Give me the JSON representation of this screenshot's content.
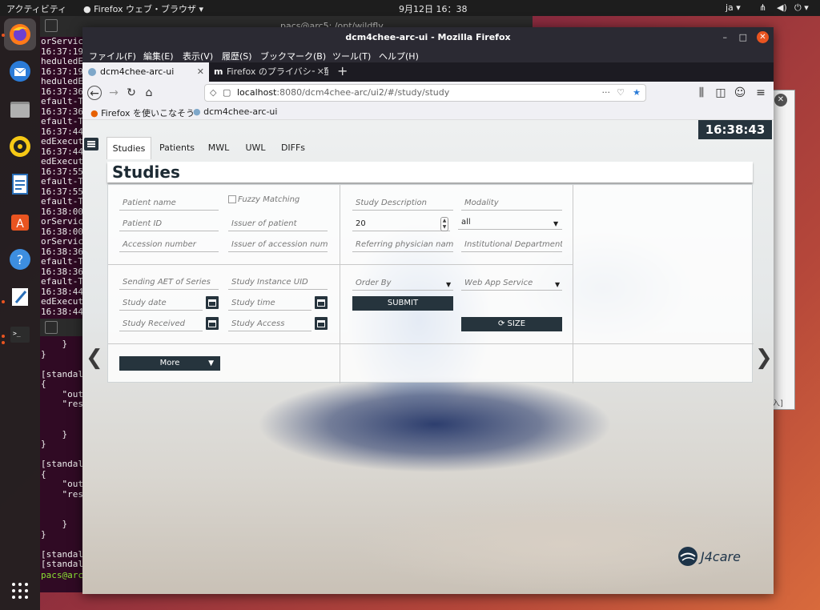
{
  "topbar": {
    "activities": "アクティビティ",
    "app_menu": "Firefox ウェブ・ブラウザ",
    "clock": "9月12日 16：38",
    "lang": "ja"
  },
  "dock": {
    "items": [
      "firefox",
      "thunderbird",
      "files",
      "rhythmbox",
      "writer",
      "software",
      "help",
      "text-editor",
      "terminal",
      "apps-grid"
    ]
  },
  "terminal": {
    "title": "pacs@arc5: /opt/wildfly",
    "lines": [
      "orService",
      "16:37:19",
      "heduledE",
      "16:37:19",
      "heduledE",
      "16:37:36",
      "efault-T",
      "16:37:36",
      "efault-T",
      "16:37:44",
      "edExecut",
      "16:37:44",
      "edExecut",
      "16:37:55",
      "efault-T",
      "16:37:55",
      "efault-T",
      "16:38:00",
      "orService",
      "16:38:00",
      "orService",
      "16:38:36",
      "efault-T",
      "16:38:36",
      "efault-T",
      "16:38:44",
      "edExecut",
      "16:38:44"
    ],
    "bottom": [
      "    }",
      "}",
      "",
      "[standalo",
      "{",
      "    \"outc",
      "    \"resp",
      "",
      "",
      "    }",
      "}",
      "",
      "[standalo",
      "{",
      "    \"outc",
      "    \"resp",
      "",
      "",
      "    }",
      "}",
      "",
      "[standalo",
      "[standalo"
    ],
    "prompt": "pacs@arc"
  },
  "right_window": {
    "text": "入]"
  },
  "firefox": {
    "title": "dcm4chee-arc-ui - Mozilla Firefox",
    "menu": [
      "ファイル(F)",
      "編集(E)",
      "表示(V)",
      "履歴(S)",
      "ブックマーク(B)",
      "ツール(T)",
      "ヘルプ(H)"
    ],
    "tabs": [
      {
        "label": "dcm4chee-arc-ui",
        "active": true
      },
      {
        "label": "Firefox のプライバシー通知",
        "active": false
      }
    ],
    "url_host": "localhost",
    "url_path": ":8080/dcm4chee-arc/ui2/#/study/study",
    "bookmarks": [
      "Firefox を使いこなそう",
      "dcm4chee-arc-ui"
    ]
  },
  "app": {
    "clock": "16:38:43",
    "tabs": [
      "Studies",
      "Patients",
      "MWL",
      "UWL",
      "DIFFs"
    ],
    "active_tab": "Studies",
    "title": "Studies",
    "filters": {
      "patient_name": "Patient name",
      "fuzzy_matching": "Fuzzy Matching",
      "patient_id": "Patient ID",
      "issuer_of_patient": "Issuer of patient",
      "accession_number": "Accession number",
      "issuer_of_accession": "Issuer of accession number",
      "study_description": "Study Description",
      "modality": "Modality",
      "limit_value": "20",
      "modality_value": "all",
      "referring_physician": "Referring physician name",
      "institutional_department": "Institutional Department",
      "sending_aet": "Sending AET of Series",
      "study_instance_uid": "Study Instance UID",
      "study_date": "Study date",
      "study_time": "Study time",
      "study_received": "Study Received",
      "study_access": "Study Access",
      "order_by": "Order By",
      "web_app_service": "Web App Service",
      "submit": "SUBMIT",
      "size": "SIZE",
      "more": "More"
    },
    "logo": "J4care"
  }
}
